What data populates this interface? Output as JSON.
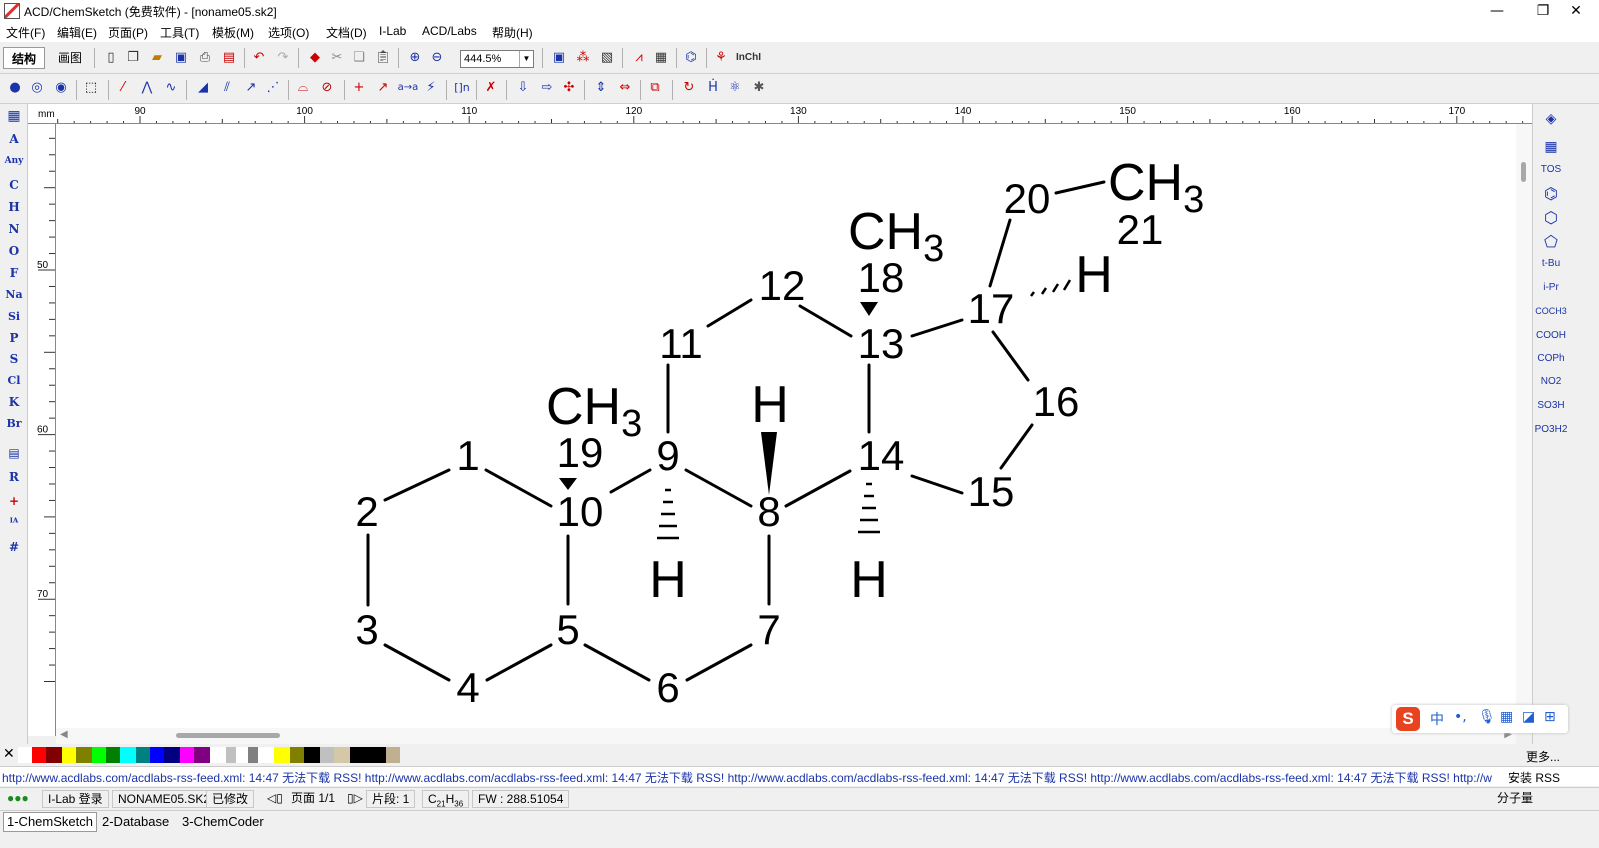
{
  "window": {
    "title": "ACD/ChemSketch (免费软件) - [noname05.sk2]",
    "controls": [
      "—",
      "❐",
      "✕"
    ]
  },
  "menu": [
    "文件(F)",
    "编辑(E)",
    "页面(P)",
    "工具(T)",
    "模板(M)",
    "选项(O)",
    "文档(D)",
    "I-Lab",
    "ACD/Labs",
    "帮助(H)"
  ],
  "toolbar": {
    "tabs": [
      "结构",
      "画图"
    ],
    "zoom": "444.5%",
    "inchi_label": "InChI"
  },
  "left_panel": [
    "A",
    "Any",
    "C",
    "H",
    "N",
    "O",
    "F",
    "Na",
    "Si",
    "P",
    "S",
    "Cl",
    "K",
    "Br",
    "R",
    "+",
    "#"
  ],
  "right_panel": [
    "TOS",
    "t-Bu",
    "i-Pr",
    "COCH3",
    "COOH",
    "COPh",
    "NO2",
    "SO3H",
    "PO3H2"
  ],
  "ruler": {
    "unit": "mm",
    "h_ticks": [
      90,
      100,
      110,
      120,
      130,
      140,
      150,
      160,
      170
    ],
    "v_ticks": [
      50,
      60,
      70
    ]
  },
  "molecule": {
    "atom_labels": [
      "1",
      "2",
      "3",
      "4",
      "5",
      "6",
      "7",
      "8",
      "9",
      "10",
      "11",
      "12",
      "13",
      "14",
      "15",
      "16",
      "17",
      "18",
      "19",
      "20",
      "21"
    ],
    "groups": {
      "ch3_19": "CH",
      "ch3_19_sub": "3",
      "ch3_18": "CH",
      "ch3_18_sub": "3",
      "ch3_21": "CH",
      "ch3_21_sub": "3",
      "h9": "H",
      "h8": "H",
      "h14": "H",
      "h17": "H"
    }
  },
  "palette": {
    "colors": [
      "#ffffff",
      "#ff0000",
      "#800000",
      "#ffff00",
      "#808000",
      "#00ff00",
      "#008000",
      "#00ffff",
      "#008080",
      "#0000ff",
      "#000080",
      "#ff00ff",
      "#800080",
      "#ffffff",
      "#c0c0c0",
      "#ffffff",
      "#808080",
      "#ffffff",
      "#ffff00",
      "#808000",
      "#000000",
      "#c0c0c0",
      "#d4c8a8",
      "#000000",
      "#000000",
      "#c0b090"
    ],
    "more": "更多..."
  },
  "rss": {
    "text": "http://www.acdlabs.com/acdlabs-rss-feed.xml: 14:47 无法下载 RSS! http://www.acdlabs.com/acdlabs-rss-feed.xml: 14:47 无法下载 RSS! http://www.acdlabs.com/acdlabs-rss-feed.xml: 14:47 无法下载 RSS! http://www.acdlabs.com/acdlabs-rss-feed.xml: 14:47 无法下载 RSS! http://w",
    "install_btn": "安装 RSS"
  },
  "status": {
    "ilab": "I-Lab 登录",
    "file": "NONAME05.SK2",
    "modified": "已修改",
    "page": "页面 1/1",
    "fragment": "片段: 1",
    "formula_c": "C",
    "formula_c_sub": "21",
    "formula_h": "H",
    "formula_h_sub": "36",
    "fw": "FW : 288.51054",
    "mol_weight": "分子量"
  },
  "taskbar": [
    "1-ChemSketch",
    "2-Database",
    "3-ChemCoder"
  ],
  "ime": {
    "logo": "S",
    "lang": "中",
    "punct": "•,"
  }
}
